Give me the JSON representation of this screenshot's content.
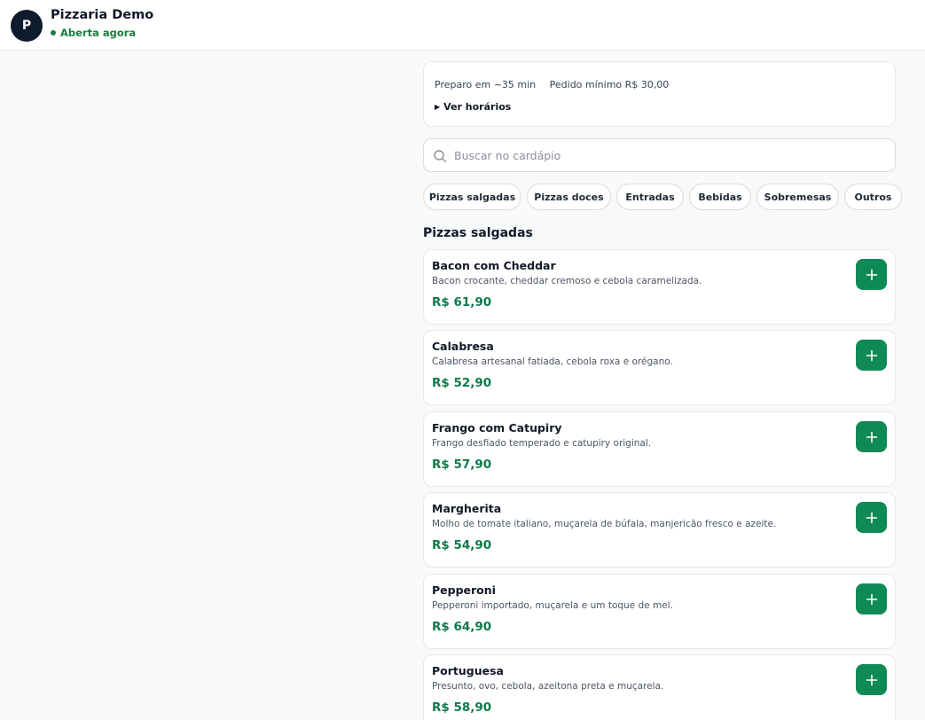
{
  "header": {
    "avatar_letter": "P",
    "store_name": "Pizzaria Demo",
    "status": "Aberta agora"
  },
  "info": {
    "prep_time": "Preparo em ~35 min",
    "min_order": "Pedido mínimo R$ 30,00",
    "hours_toggle": "Ver horários"
  },
  "search": {
    "placeholder": "Buscar no cardápio",
    "value": ""
  },
  "categories": [
    "Pizzas salgadas",
    "Pizzas doces",
    "Entradas",
    "Bebidas",
    "Sobremesas",
    "Outros"
  ],
  "section": {
    "title": "Pizzas salgadas",
    "items": [
      {
        "name": "Bacon com Cheddar",
        "description": "Bacon crocante, cheddar cremoso e cebola caramelizada.",
        "price": "R$ 61,90"
      },
      {
        "name": "Calabresa",
        "description": "Calabresa artesanal fatiada, cebola roxa e orégano.",
        "price": "R$ 52,90"
      },
      {
        "name": "Frango com Catupiry",
        "description": "Frango desfiado temperado e catupiry original.",
        "price": "R$ 57,90"
      },
      {
        "name": "Margherita",
        "description": "Molho de tomate italiano, muçarela de búfala, manjericão fresco e azeite.",
        "price": "R$ 54,90"
      },
      {
        "name": "Pepperoni",
        "description": "Pepperoni importado, muçarela e um toque de mel.",
        "price": "R$ 64,90"
      },
      {
        "name": "Portuguesa",
        "description": "Presunto, ovo, cebola, azeitona preta e muçarela.",
        "price": "R$ 58,90"
      }
    ]
  },
  "colors": {
    "accent": "#0f8a55",
    "price": "#0f7a4a",
    "status": "#15803d",
    "avatar_bg": "#0f1b2d"
  },
  "icons": {
    "search": "search-icon",
    "add": "plus-icon",
    "status": "status-dot-icon",
    "expand": "triangle-right-icon"
  }
}
